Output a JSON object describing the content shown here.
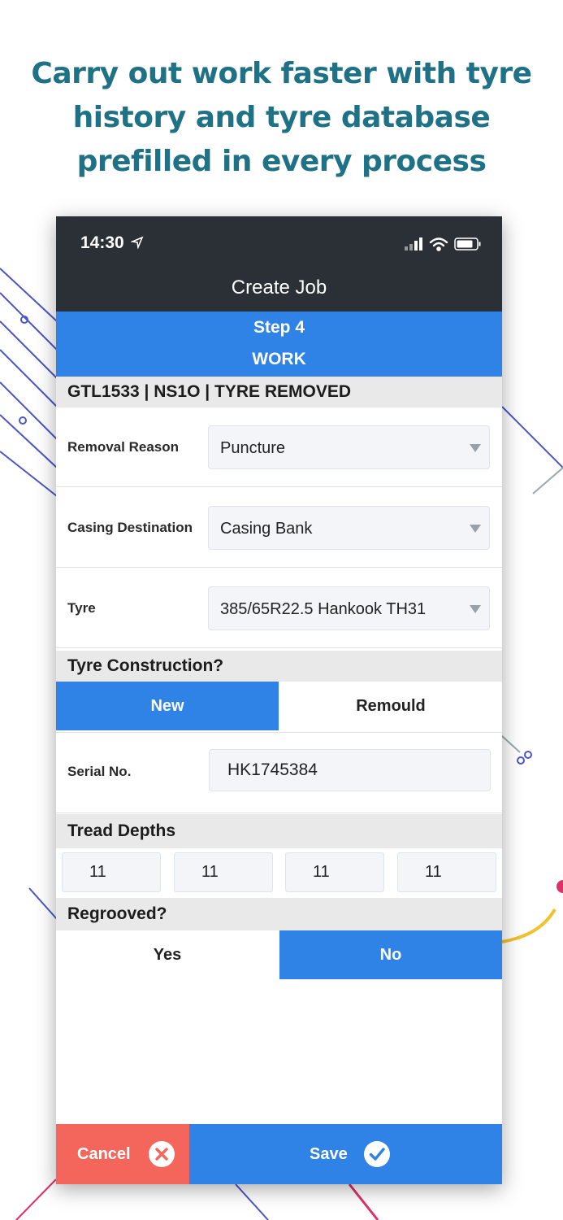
{
  "headline": {
    "line1": "Carry out work faster with tyre",
    "line2": "history and tyre database",
    "line3": "prefilled in every process"
  },
  "status_bar": {
    "time": "14:30"
  },
  "nav": {
    "title": "Create Job"
  },
  "step": {
    "number": "Step 4",
    "title": "WORK"
  },
  "job_header": "GTL1533 | NS1O | TYRE REMOVED",
  "fields": {
    "removal_reason": {
      "label": "Removal Reason",
      "value": "Puncture"
    },
    "casing_destination": {
      "label": "Casing Destination",
      "value": "Casing Bank"
    },
    "tyre": {
      "label": "Tyre",
      "value": "385/65R22.5 Hankook TH31"
    }
  },
  "tyre_construction": {
    "label": "Tyre Construction?",
    "options": [
      "New",
      "Remould"
    ],
    "selected": "New"
  },
  "serial": {
    "label": "Serial No.",
    "value": "HK1745384"
  },
  "tread_depths": {
    "label": "Tread Depths",
    "values": [
      "11",
      "11",
      "11",
      "11"
    ]
  },
  "regrooved": {
    "label": "Regrooved?",
    "options": [
      "Yes",
      "No"
    ],
    "selected": "No"
  },
  "footer": {
    "cancel_label": "Cancel",
    "save_label": "Save"
  },
  "colors": {
    "headline": "#1f7186",
    "dark_bar": "#2b3036",
    "accent_blue": "#2f83e6",
    "cancel_red": "#f4665c",
    "section_gray": "#e9e9e9"
  },
  "icons": [
    "location-arrow-icon",
    "cellular-signal-icon",
    "wifi-icon",
    "battery-icon",
    "dropdown-caret-icon",
    "close-circle-icon",
    "check-circle-icon"
  ]
}
